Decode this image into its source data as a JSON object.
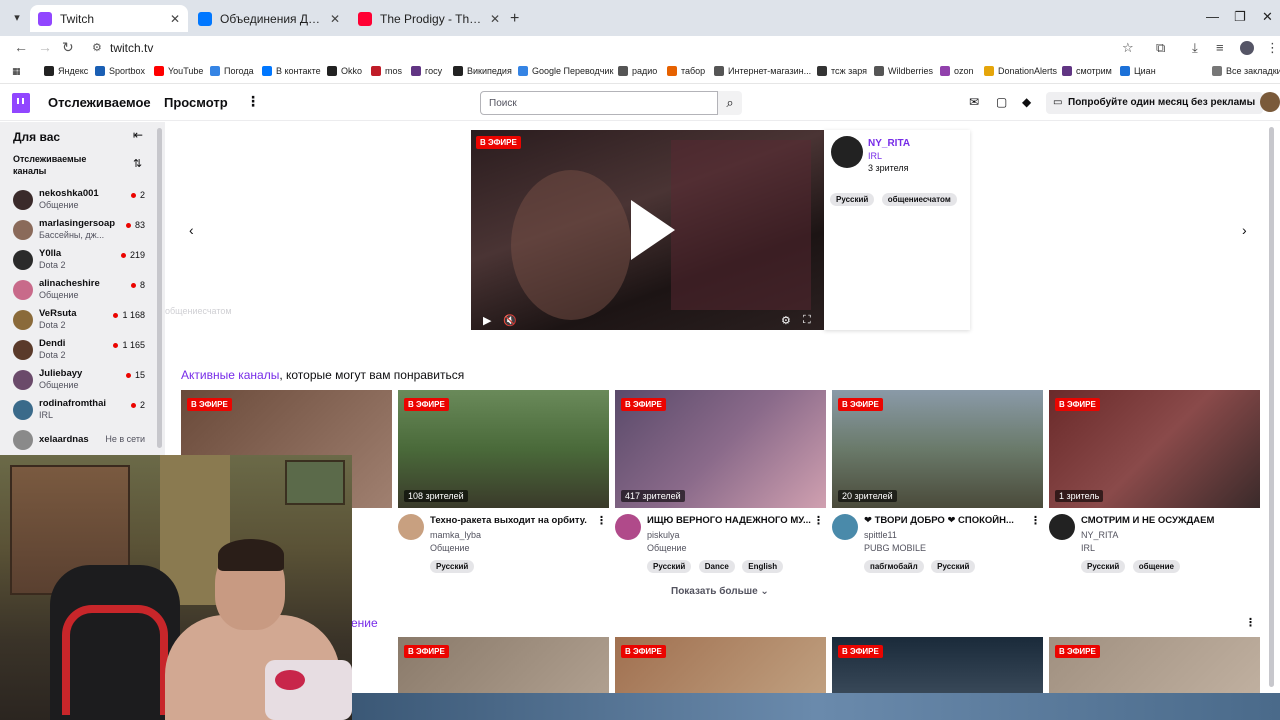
{
  "browser": {
    "tabs": [
      {
        "label": "Twitch",
        "color": "#9146ff",
        "active": true
      },
      {
        "label": "Объединения Дмитрия Зорин",
        "color": "#0077ff",
        "active": false
      },
      {
        "label": "The Prodigy - Their Law (Live in",
        "color": "#ff0033",
        "active": false
      }
    ],
    "url": "twitch.tv",
    "bookmarks": [
      {
        "label": "Яндекс",
        "color": "#222222"
      },
      {
        "label": "Sportbox",
        "color": "#1a5fb4"
      },
      {
        "label": "YouTube",
        "color": "#ff0000"
      },
      {
        "label": "Погода",
        "color": "#3584e4"
      },
      {
        "label": "В контакте",
        "color": "#0077ff"
      },
      {
        "label": "Okko",
        "color": "#222222"
      },
      {
        "label": "mos",
        "color": "#c01c28"
      },
      {
        "label": "госу",
        "color": "#613583"
      },
      {
        "label": "Википедия",
        "color": "#222222"
      },
      {
        "label": "Google Переводчик",
        "color": "#3584e4"
      },
      {
        "label": "радио",
        "color": "#555555"
      },
      {
        "label": "табор",
        "color": "#e66100"
      },
      {
        "label": "Интернет-магазин...",
        "color": "#555555"
      },
      {
        "label": "тсж заря",
        "color": "#333333"
      },
      {
        "label": "Wildberries",
        "color": "#555555"
      },
      {
        "label": "ozon",
        "color": "#9141ac"
      },
      {
        "label": "DonationAlerts",
        "color": "#e5a50a"
      },
      {
        "label": "смотрим",
        "color": "#613583"
      },
      {
        "label": "Циан",
        "color": "#1c71d8"
      }
    ],
    "all_bookmarks": "Все закладки"
  },
  "nav": {
    "following": "Отслеживаемое",
    "browse": "Просмотр",
    "search_placeholder": "Поиск",
    "promo": "Попробуйте один месяц без рекламы"
  },
  "sidebar": {
    "title": "Для вас",
    "followed_title": "Отслеживаемые каналы",
    "channels": [
      {
        "name": "nekoshka001",
        "game": "Общение",
        "count": "2",
        "live": true,
        "color": "#3a2a2a"
      },
      {
        "name": "marlasingersoap",
        "game": "Бассейны, дж...",
        "count": "83",
        "live": true,
        "color": "#8a6a5a"
      },
      {
        "name": "Y0lla",
        "game": "Dota 2",
        "count": "219",
        "live": true,
        "color": "#2a2a2a"
      },
      {
        "name": "alinacheshire",
        "game": "Общение",
        "count": "8",
        "live": true,
        "color": "#c86a8a"
      },
      {
        "name": "VeRsuta",
        "game": "Dota 2",
        "count": "1 168",
        "live": true,
        "color": "#8a6a3a"
      },
      {
        "name": "Dendi",
        "game": "Dota 2",
        "count": "1 165",
        "live": true,
        "color": "#5a3a2a"
      },
      {
        "name": "Juliebayy",
        "game": "Общение",
        "count": "15",
        "live": true,
        "color": "#6a4a6a"
      },
      {
        "name": "rodinafromthai",
        "game": "IRL",
        "count": "2",
        "live": true,
        "color": "#3a6a8a"
      },
      {
        "name": "xelaardnas",
        "game": "",
        "count": "Не в сети",
        "live": false,
        "color": "#8a8a8a"
      }
    ]
  },
  "featured": {
    "live": "В ЭФИРЕ",
    "name": "NY_RITA",
    "game": "IRL",
    "viewers": "3 зрителя",
    "tags": [
      "Русский",
      "общениесчатом"
    ],
    "ghost_text": "общениесчатом"
  },
  "recommended": {
    "title_link": "Активные каналы",
    "title_rest": ", которые могут вам понравиться",
    "cards": [
      {
        "live": "В ЭФИРЕ",
        "viewers": "",
        "title": "",
        "channel": "",
        "game": "",
        "tags": [],
        "thumb": "linear-gradient(135deg,#6a4a3a,#a08070)",
        "av": "#777777"
      },
      {
        "live": "В ЭФИРЕ",
        "viewers": "108 зрителей",
        "title": "Техно-ракета выходит на орбиту.",
        "channel": "mamka_lyba",
        "game": "Общение",
        "tags": [
          "Русский"
        ],
        "thumb": "linear-gradient(180deg,#6a8a5a,#4a6a3a 50%,#3a3a2a)",
        "av": "#c8a080"
      },
      {
        "live": "В ЭФИРЕ",
        "viewers": "417 зрителей",
        "title": "ИЩЮ ВЕРНОГО НАДЕЖНОГО МУ...",
        "channel": "piskulya",
        "game": "Общение",
        "tags": [
          "Русский",
          "Dance",
          "English"
        ],
        "thumb": "linear-gradient(135deg,#5a4a6a,#8a6a8a 50%,#d0a0b0)",
        "av": "#b04a8a"
      },
      {
        "live": "В ЭФИРЕ",
        "viewers": "20 зрителей",
        "title": "❤ ТВОРИ ДОБРО ❤ СПОКОЙН...",
        "channel": "spittle11",
        "game": "PUBG MOBILE",
        "tags": [
          "пабгмобайл",
          "Русский"
        ],
        "thumb": "linear-gradient(180deg,#8a9aa8,#6a7a6a 50%,#4a4a3a)",
        "av": "#4a8aaa"
      },
      {
        "live": "В ЭФИРЕ",
        "viewers": "1 зритель",
        "title": "СМОТРИМ И НЕ ОСУЖДАЕМ",
        "channel": "NY_RITA",
        "game": "IRL",
        "tags": [
          "Русский",
          "общение"
        ],
        "thumb": "linear-gradient(135deg,#6a2a2a,#8a4a4a 50%,#3a2a2a)",
        "av": "#222222"
      }
    ],
    "show_more": "Показать больше"
  },
  "section2": {
    "title_fragment": "ение",
    "cards": [
      {
        "live": "В ЭФИРЕ",
        "thumb": "linear-gradient(135deg,#8a7a6a,#b0a090)"
      },
      {
        "live": "В ЭФИРЕ",
        "thumb": "linear-gradient(135deg,#a07050,#c0a080)"
      },
      {
        "live": "В ЭФИРЕ",
        "thumb": "linear-gradient(180deg,#1a2a3a,#3a4a5a)"
      },
      {
        "live": "В ЭФИРЕ",
        "thumb": "linear-gradient(135deg,#a09080,#c0b0a0)"
      }
    ]
  },
  "colors": {
    "accent": "#9146ff",
    "live": "#eb0400",
    "link": "#772ce8"
  }
}
